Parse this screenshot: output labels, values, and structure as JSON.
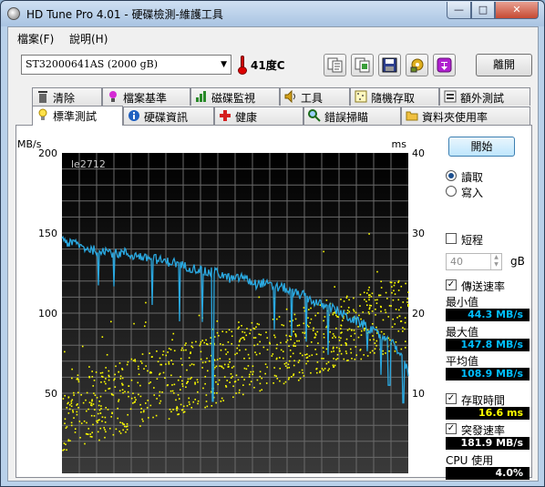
{
  "window": {
    "title": "HD Tune Pro 4.01 - 硬碟檢測-維護工具",
    "min_label": "—",
    "max_label": "□",
    "close_label": "✕"
  },
  "menu": [
    "檔案(F)",
    "說明(H)"
  ],
  "toolbar": {
    "drive": "ST32000641AS (2000 gB)",
    "temperature": "41度C",
    "exit_label": "離開",
    "icons": [
      "copy-text-icon",
      "copy-screenshot-icon",
      "save-icon",
      "options-icon",
      "download-icon"
    ]
  },
  "tabs_back": [
    {
      "label": "清除",
      "icon": "trash-icon"
    },
    {
      "label": "檔案基準",
      "icon": "file-benchmark-icon"
    },
    {
      "label": "磁碟監視",
      "icon": "disk-monitor-icon"
    },
    {
      "label": "工具",
      "icon": "speaker-icon"
    },
    {
      "label": "隨機存取",
      "icon": "random-access-icon"
    },
    {
      "label": "額外測試",
      "icon": "extra-tests-icon"
    }
  ],
  "tabs_front": [
    {
      "label": "標準測試",
      "icon": "lightbulb-icon",
      "active": true
    },
    {
      "label": "硬碟資訊",
      "icon": "info-icon"
    },
    {
      "label": "健康",
      "icon": "health-cross-icon"
    },
    {
      "label": "錯誤掃瞄",
      "icon": "magnifier-icon"
    },
    {
      "label": "資料夾使用率",
      "icon": "folder-icon"
    }
  ],
  "controls": {
    "start_label": "開始",
    "read_label": "讀取",
    "write_label": "寫入",
    "mode": "read",
    "short_stroke_label": "短程",
    "short_stroke_checked": false,
    "short_stroke_value": "40",
    "short_stroke_unit": "gB",
    "transfer_rate_label": "傳送速率",
    "transfer_rate_checked": true,
    "min_label": "最小值",
    "min_value": "44.3 MB/s",
    "max_label": "最大值",
    "max_value": "147.8 MB/s",
    "avg_label": "平均值",
    "avg_value": "108.9 MB/s",
    "access_time_label": "存取時間",
    "access_time_checked": true,
    "access_time_value": "16.6 ms",
    "burst_rate_label": "突發速率",
    "burst_rate_checked": true,
    "burst_rate_value": "181.9 MB/s",
    "cpu_label": "CPU 使用",
    "cpu_value": "4.0%",
    "colors": {
      "transfer": "#00bfff",
      "access": "#ffff00",
      "value_text": "#00bfff",
      "access_value_text": "#ffff00",
      "burst_value_text": "#ffffff",
      "cpu_value_text": "#ffffff"
    }
  },
  "chart_data": {
    "type": "line",
    "left_axis_label": "MB/s",
    "right_axis_label": "ms",
    "watermark": "le2712",
    "ylim_left": [
      0,
      200
    ],
    "ylim_right": [
      0,
      40
    ],
    "yticks_left": [
      "200",
      "150",
      "100",
      "50"
    ],
    "yticks_right": [
      "40",
      "30",
      "20",
      "10"
    ],
    "grid": true,
    "x_range": [
      0,
      100
    ],
    "series": [
      {
        "axis": "left",
        "color": "#2aa8e0",
        "x": [
          0,
          2,
          4,
          6,
          8,
          10,
          12,
          14,
          16,
          18,
          20,
          22,
          24,
          26,
          28,
          30,
          32,
          34,
          36,
          38,
          40,
          42,
          44,
          46,
          48,
          50,
          52,
          54,
          56,
          58,
          60,
          62,
          64,
          66,
          68,
          70,
          72,
          74,
          76,
          78,
          80,
          82,
          84,
          86,
          88,
          90,
          92,
          94,
          96,
          98,
          100
        ],
        "values": [
          148,
          143,
          144,
          141,
          140,
          139,
          140,
          138,
          137,
          138,
          136,
          136,
          134,
          135,
          133,
          132,
          132,
          130,
          129,
          128,
          127,
          125,
          126,
          124,
          122,
          121,
          123,
          120,
          118,
          119,
          117,
          116,
          116,
          113,
          112,
          111,
          108,
          106,
          104,
          103,
          101,
          98,
          96,
          94,
          92,
          88,
          86,
          82,
          80,
          74,
          63
        ]
      },
      {
        "axis": "right",
        "type": "scatter",
        "color": "#ffff00",
        "summary": "random access time samples, approx. 5–28 ms, rising trend"
      }
    ]
  }
}
